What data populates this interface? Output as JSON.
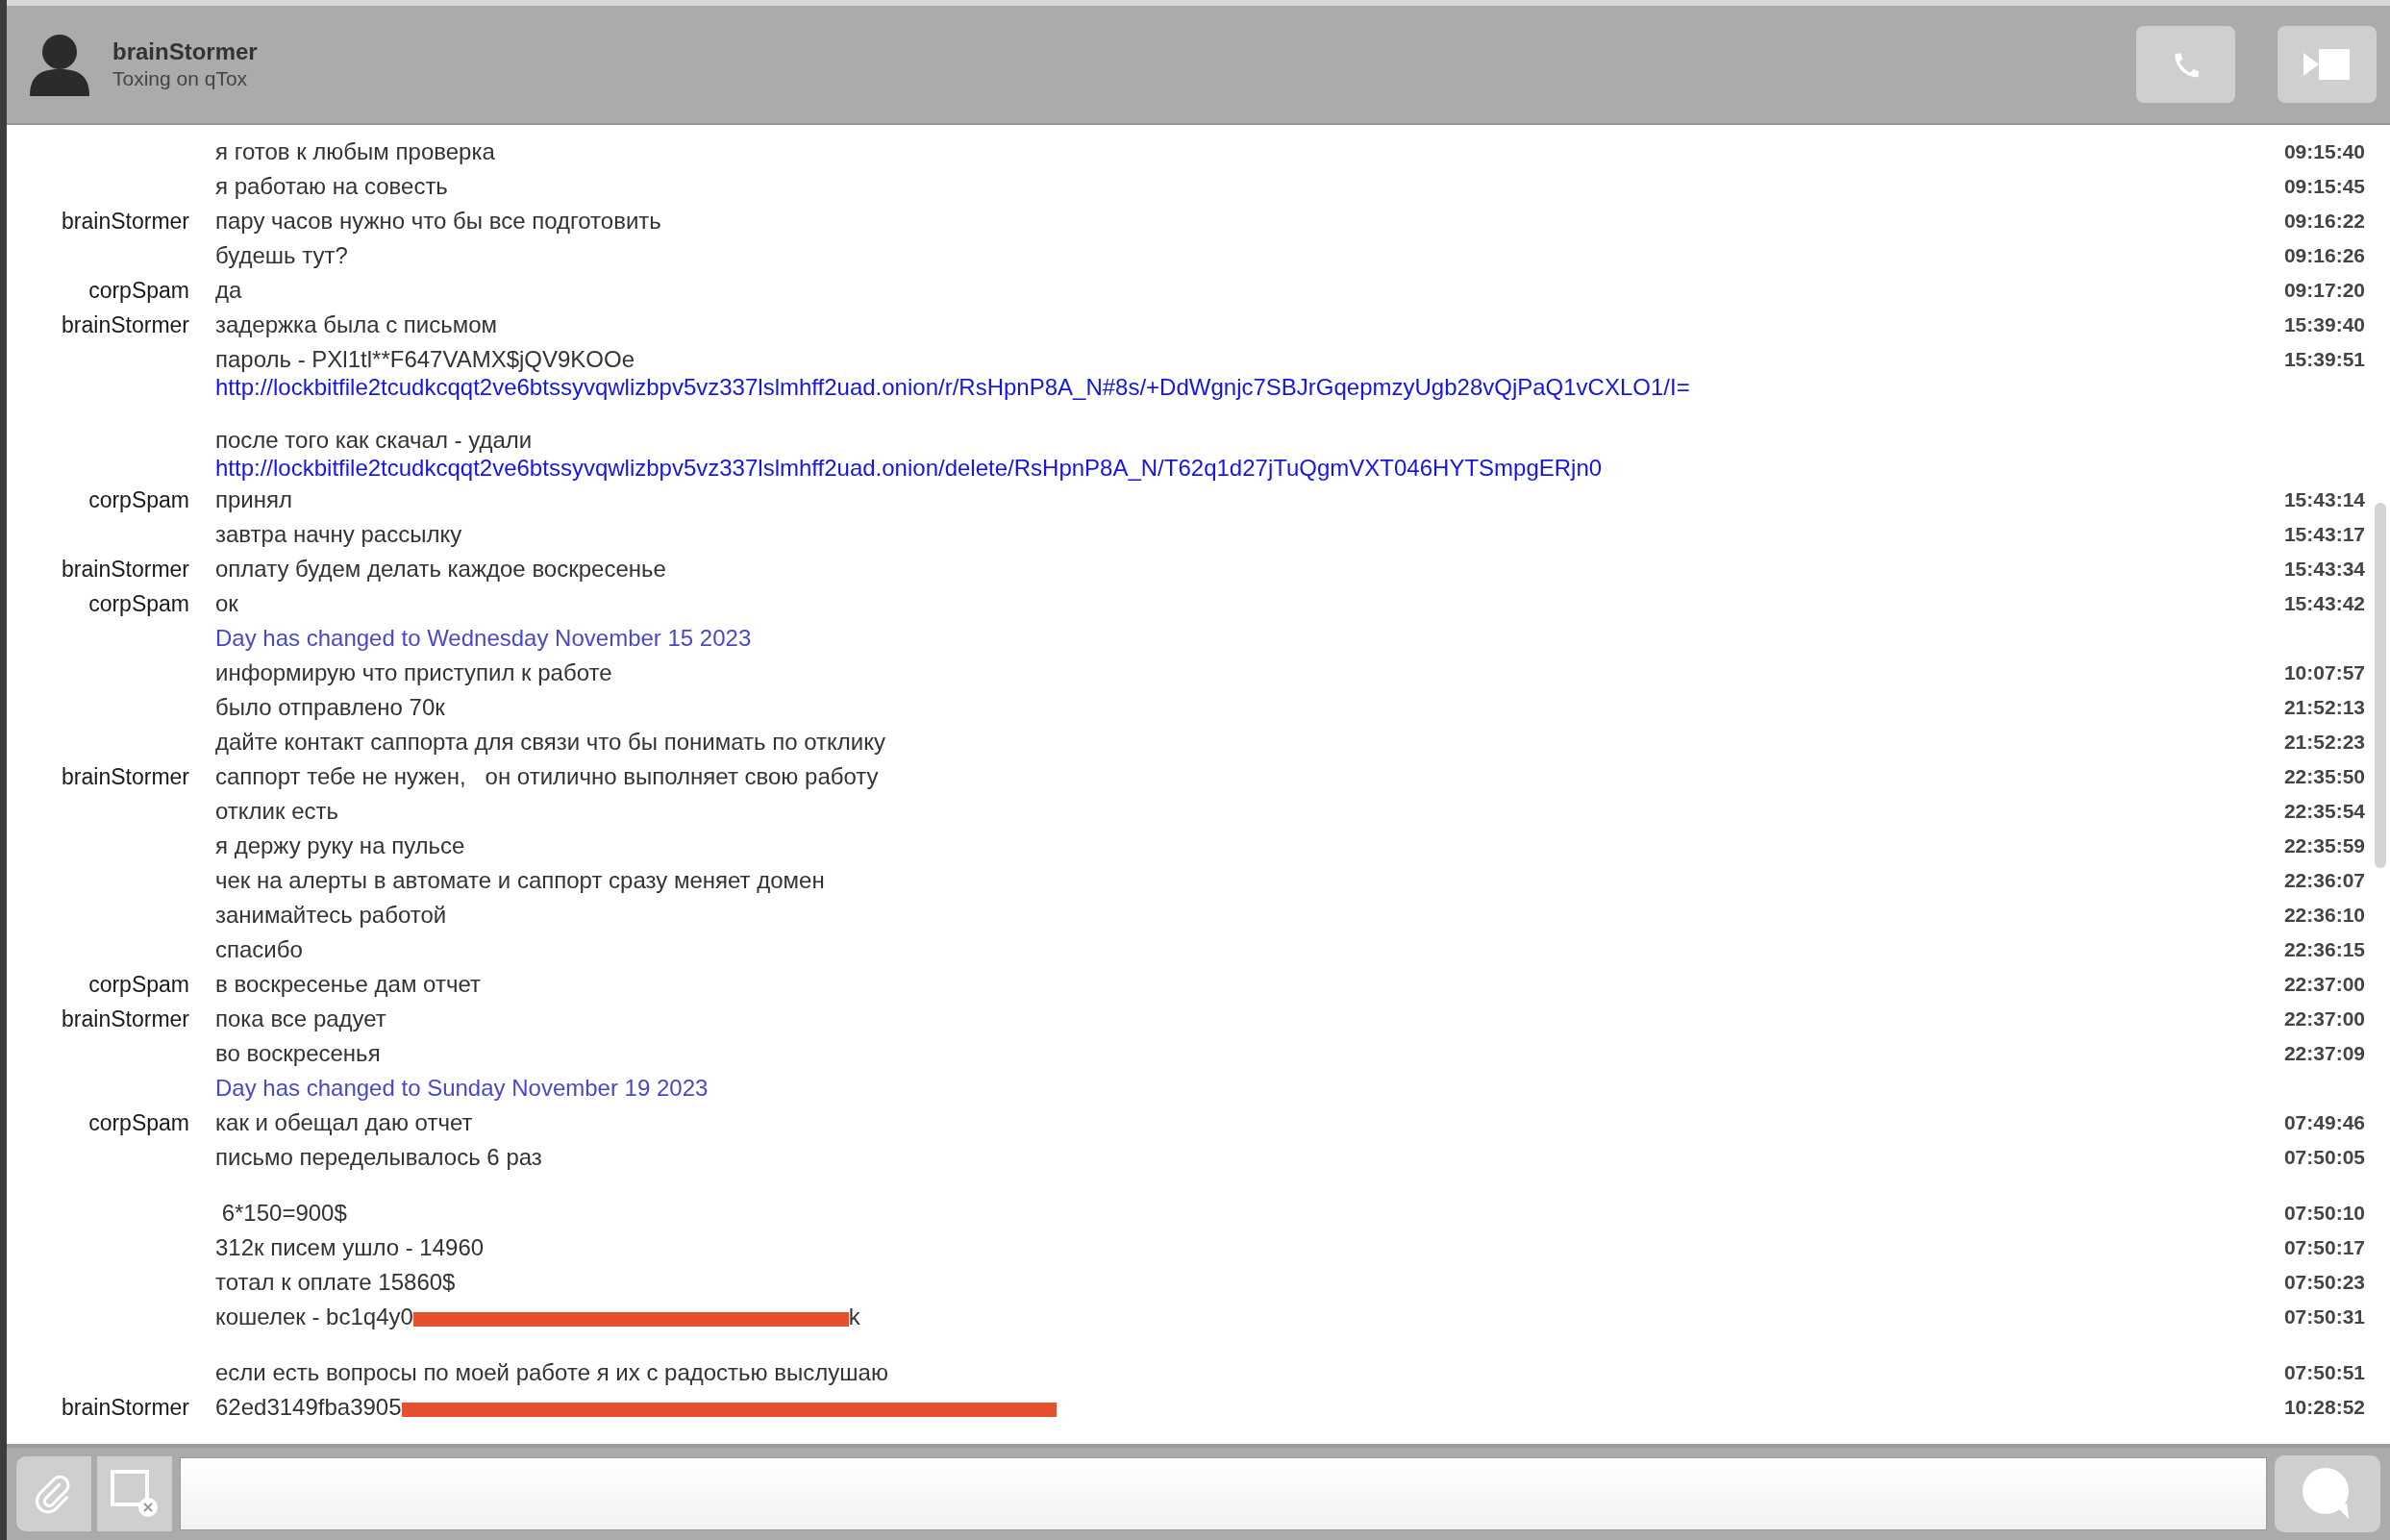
{
  "header": {
    "name": "brainStormer",
    "status": "Toxing on qTox"
  },
  "messages": [
    {
      "kind": "text",
      "text": "я готов к любым проверка",
      "time": "09:15:40"
    },
    {
      "kind": "text",
      "text": "я работаю на совесть",
      "time": "09:15:45"
    },
    {
      "kind": "text",
      "author": "brainStormer",
      "text": "пару часов нужно что бы все подготовить",
      "time": "09:16:22"
    },
    {
      "kind": "text",
      "text": "будешь тут?",
      "time": "09:16:26"
    },
    {
      "kind": "text",
      "author": "corpSpam",
      "text": "да",
      "time": "09:17:20"
    },
    {
      "kind": "text",
      "author": "brainStormer",
      "text": "задержка была с письмом",
      "time": "15:39:40"
    },
    {
      "kind": "text",
      "text": "пароль - PXl1tl**F647VAMX$jQV9KOOe",
      "time": "15:39:51"
    },
    {
      "kind": "link",
      "text": "http://lockbitfile2tcudkcqqt2ve6btssyvqwlizbpv5vz337lslmhff2uad.onion/r/RsHpnP8A_N#8s/+DdWgnjc7SBJrGqepmzyUgb28vQjPaQ1vCXLO1/I="
    },
    {
      "kind": "text",
      "text": "после того как скачал - удали",
      "blank_before": true
    },
    {
      "kind": "link",
      "text": "http://lockbitfile2tcudkcqqt2ve6btssyvqwlizbpv5vz337lslmhff2uad.onion/delete/RsHpnP8A_N/T62q1d27jTuQgmVXT046HYTSmpgERjn0"
    },
    {
      "kind": "text",
      "author": "corpSpam",
      "text": "принял",
      "time": "15:43:14"
    },
    {
      "kind": "text",
      "text": "завтра начну рассылку",
      "time": "15:43:17"
    },
    {
      "kind": "text",
      "author": "brainStormer",
      "text": "оплату будем делать каждое воскресенье",
      "time": "15:43:34"
    },
    {
      "kind": "text",
      "author": "corpSpam",
      "text": "ок",
      "time": "15:43:42"
    },
    {
      "kind": "day",
      "text": "Day has changed to Wednesday November 15 2023"
    },
    {
      "kind": "text",
      "text": "информирую что приступил к работе",
      "time": "10:07:57"
    },
    {
      "kind": "text",
      "text": "было отправлено 70к",
      "time": "21:52:13"
    },
    {
      "kind": "text",
      "text": "дайте контакт саппорта для связи что бы понимать по отклику",
      "time": "21:52:23"
    },
    {
      "kind": "text",
      "author": "brainStormer",
      "text": "саппорт тебе не нужен,   он отилично выполняет свою работу",
      "time": "22:35:50"
    },
    {
      "kind": "text",
      "text": "отклик есть",
      "time": "22:35:54"
    },
    {
      "kind": "text",
      "text": "я держу руку на пульсе",
      "time": "22:35:59"
    },
    {
      "kind": "text",
      "text": "чек на алерты в автомате и саппорт сразу меняет домен",
      "time": "22:36:07"
    },
    {
      "kind": "text",
      "text": "занимайтесь работой",
      "time": "22:36:10"
    },
    {
      "kind": "text",
      "text": "спасибо",
      "time": "22:36:15"
    },
    {
      "kind": "text",
      "author": "corpSpam",
      "text": "в воскресенье дам отчет",
      "time": "22:37:00"
    },
    {
      "kind": "text",
      "author": "brainStormer",
      "text": "пока все радует",
      "time": "22:37:00"
    },
    {
      "kind": "text",
      "text": "во воскресенья",
      "time": "22:37:09"
    },
    {
      "kind": "day",
      "text": "Day has changed to Sunday November 19 2023"
    },
    {
      "kind": "text",
      "author": "corpSpam",
      "text": "как и обещал даю отчет",
      "time": "07:49:46"
    },
    {
      "kind": "text",
      "text": "письмо переделывалось 6 раз",
      "time": "07:50:05"
    },
    {
      "kind": "text",
      "text": " 6*150=900$",
      "time": "07:50:10",
      "blank_before": true
    },
    {
      "kind": "text",
      "text": "312к писем ушло - 14960",
      "time": "07:50:17"
    },
    {
      "kind": "text",
      "text": "тотал к оплате 15860$",
      "time": "07:50:23"
    },
    {
      "kind": "text",
      "text": "кошелек - bc1q4y0",
      "redacted": true,
      "tail": "k",
      "time": "07:50:31"
    },
    {
      "kind": "text",
      "text": "если есть вопросы по моей работе я их с радостью выслушаю",
      "time": "07:50:51",
      "blank_before": true
    },
    {
      "kind": "text",
      "author": "brainStormer",
      "text": "62ed3149fba3905",
      "redacted": true,
      "time": "10:28:52"
    }
  ]
}
